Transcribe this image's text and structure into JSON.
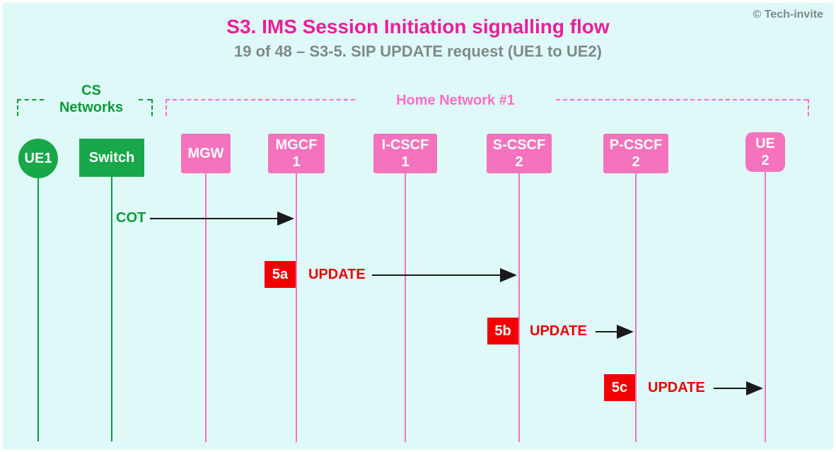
{
  "title": "S3. IMS Session Initiation signalling flow",
  "subtitle": "19 of 48 – S3-5. SIP UPDATE request (UE1 to UE2)",
  "copyright": "© Tech-invite",
  "groups": {
    "cs": "CS\nNetworks",
    "home": "Home Network #1"
  },
  "nodes": {
    "ue1": "UE1",
    "switch": "Switch",
    "mgw": "MGW",
    "mgcf1_l1": "MGCF",
    "mgcf1_l2": "1",
    "icscf1_l1": "I-CSCF",
    "icscf1_l2": "1",
    "scscf2_l1": "S-CSCF",
    "scscf2_l2": "2",
    "pcscf2_l1": "P-CSCF",
    "pcscf2_l2": "2",
    "ue2_l1": "UE",
    "ue2_l2": "2"
  },
  "messages": {
    "cot": "COT",
    "update": "UPDATE"
  },
  "steps": {
    "s5a": "5a",
    "s5b": "5b",
    "s5c": "5c"
  }
}
